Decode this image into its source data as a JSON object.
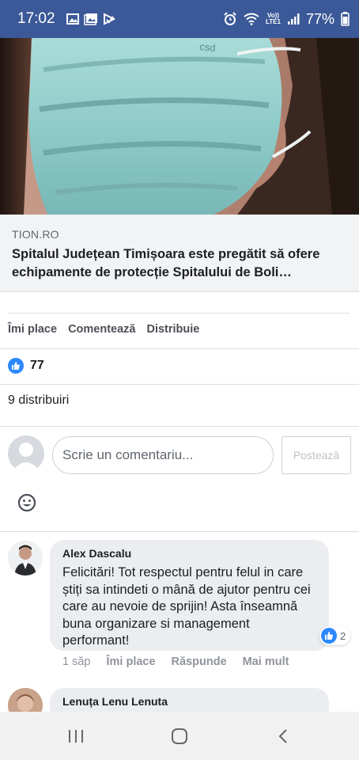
{
  "status_bar": {
    "time": "17:02",
    "network_top": "Vo))",
    "network_bottom": "LTE1",
    "battery": "77%",
    "icons": [
      "gallery-icon",
      "image-icon",
      "play-store-icon",
      "alarm-icon",
      "wifi-icon",
      "signal-icon",
      "battery-icon"
    ]
  },
  "post": {
    "link_domain": "TION.RO",
    "link_title": "Spitalul Județean Timișoara este pregătit să ofere echipamente de protecție Spitalului de Boli…",
    "actions": {
      "like": "Îmi place",
      "comment": "Comentează",
      "share": "Distribuie"
    },
    "reaction_count": "77",
    "shares_text": "9 distribuiri"
  },
  "composer": {
    "placeholder": "Scrie un comentariu...",
    "post_button": "Postează"
  },
  "comments": [
    {
      "author": "Alex Dascalu",
      "text": "Felicitări! Tot respectul pentru felul in care știți sa intindeti o mână de ajutor pentru cei care au nevoie de sprijin! Asta înseamnă buna organizare si management performant!",
      "reaction_count": "2",
      "time": "1 săp",
      "like_label": "Îmi place",
      "reply_label": "Răspunde",
      "more_label": "Mai mult"
    },
    {
      "author": "Lenuța Lenu Lenuta"
    }
  ],
  "colors": {
    "facebook_blue": "#3b5998",
    "like_blue": "#2d88ff",
    "bubble_gray": "#ebedf0"
  }
}
